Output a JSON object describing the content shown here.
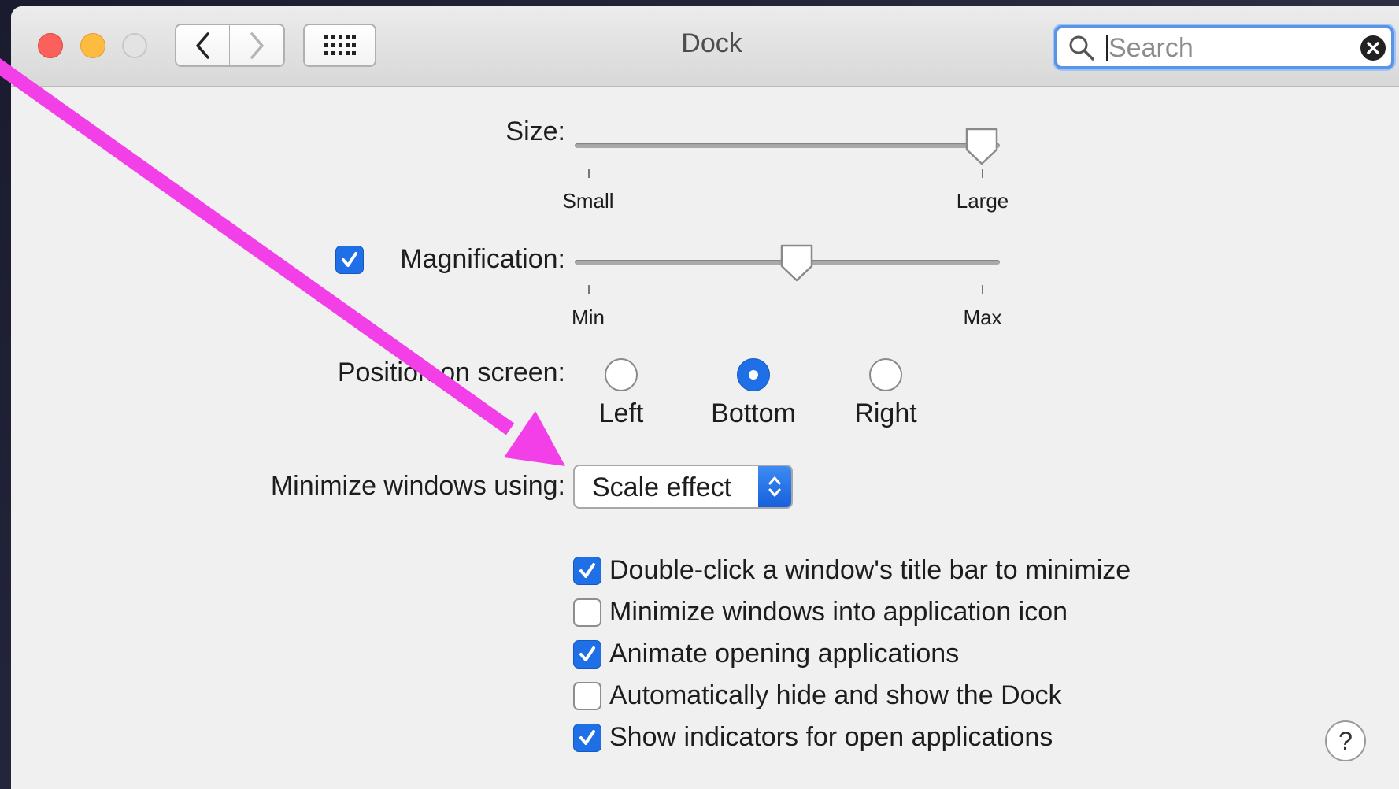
{
  "window": {
    "title": "Dock"
  },
  "search": {
    "placeholder": "Search"
  },
  "size": {
    "label": "Size:",
    "min_label": "Small",
    "max_label": "Large",
    "value": 1.0
  },
  "magnification": {
    "label": "Magnification:",
    "checked": true,
    "min_label": "Min",
    "max_label": "Max",
    "value": 0.53
  },
  "position": {
    "label": "Position on screen:",
    "options": [
      "Left",
      "Bottom",
      "Right"
    ],
    "selected": "Bottom"
  },
  "minimize": {
    "label": "Minimize windows using:",
    "value": "Scale effect"
  },
  "options": [
    {
      "label": "Double-click a window's title bar to minimize",
      "checked": true
    },
    {
      "label": "Minimize windows into application icon",
      "checked": false
    },
    {
      "label": "Animate opening applications",
      "checked": true
    },
    {
      "label": "Automatically hide and show the Dock",
      "checked": false
    },
    {
      "label": "Show indicators for open applications",
      "checked": true
    }
  ],
  "help": {
    "label": "?"
  },
  "colors": {
    "accent": "#1f6fe6",
    "annotation": "#f23fe8"
  }
}
